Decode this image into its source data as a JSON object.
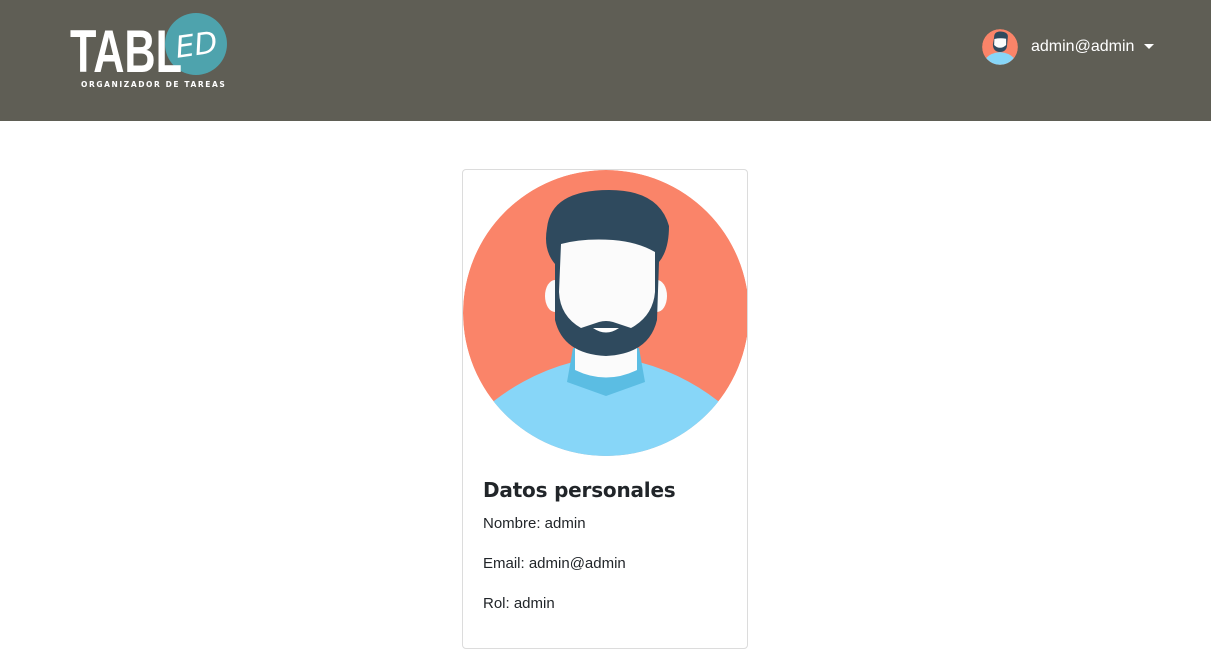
{
  "brand": {
    "logo_text": "TABLED",
    "logo_main": "TABL",
    "logo_circle": "ED",
    "tagline": "ORGANIZADOR DE TAREAS"
  },
  "colors": {
    "nav_bg": "#5f5e55",
    "logo_circle": "#4ea3ad",
    "avatar_bg": "#fa8469",
    "hair": "#2f4a5e",
    "shirt": "#87d6f8",
    "collar": "#5bbde3"
  },
  "user_menu": {
    "email": "admin@admin",
    "avatar_icon": "user-avatar-icon",
    "dropdown_icon": "caret-down-icon"
  },
  "profile_card": {
    "title": "Datos personales",
    "nombre": "Nombre: admin",
    "email": "Email: admin@admin",
    "rol": "Rol: admin"
  }
}
